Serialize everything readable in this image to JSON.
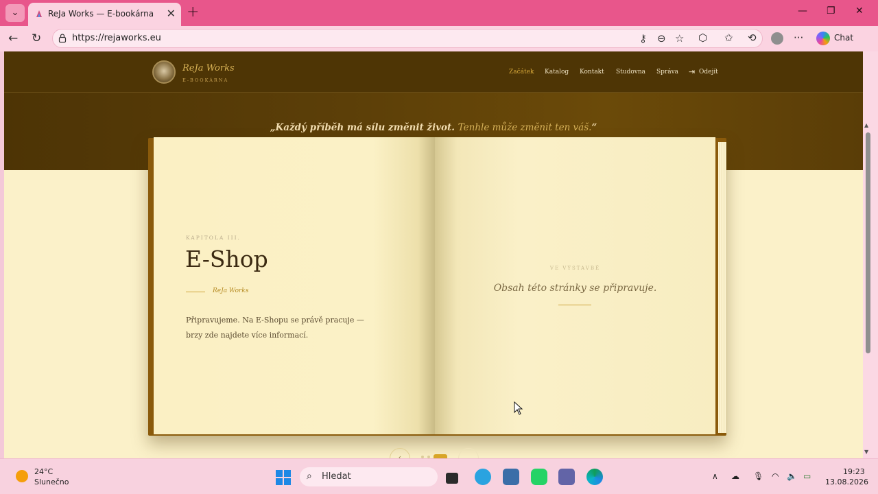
{
  "browser": {
    "tab_title": "ReJa Works — E-bookárna",
    "url": "https://rejaworks.eu",
    "chat_label": "Chat"
  },
  "site": {
    "brand_name": "ReJa Works",
    "brand_sub": "E-BOOKÁRNA",
    "nav": {
      "home": "Začátek",
      "catalog": "Katalog",
      "contact": "Kontakt",
      "study": "Studovna",
      "admin": "Správa",
      "logout": "Odejít"
    },
    "quote_main": "„Každý příběh má sílu změnit život. ",
    "quote_accent": "Tenhle může změnit ten váš.",
    "quote_end": "“"
  },
  "book": {
    "left": {
      "chapter": "KAPITOLA III.",
      "title": "E-Shop",
      "author": "ReJa Works",
      "body": "Připravujeme. Na E-Shopu se právě pracuje — brzy zde najdete více informací."
    },
    "right": {
      "status_label": "VE VÝSTAVBĚ",
      "status_text": "Obsah této stránky se připravuje."
    }
  },
  "pager": {
    "prev": "‹"
  },
  "taskbar": {
    "weather_temp": "24°C",
    "weather_desc": "Slunečno",
    "search_placeholder": "Hledat",
    "time": "19:23",
    "date": "13.08.2026"
  },
  "icons": [
    "tab-list-icon",
    "back-icon",
    "reload-icon",
    "lock-icon",
    "key-icon",
    "zoom-icon",
    "favorite-star-icon",
    "extensions-icon",
    "favorites-icon",
    "history-icon",
    "profile-icon",
    "more-icon",
    "copilot-icon",
    "logout-icon",
    "windows-start-icon",
    "search-icon"
  ]
}
